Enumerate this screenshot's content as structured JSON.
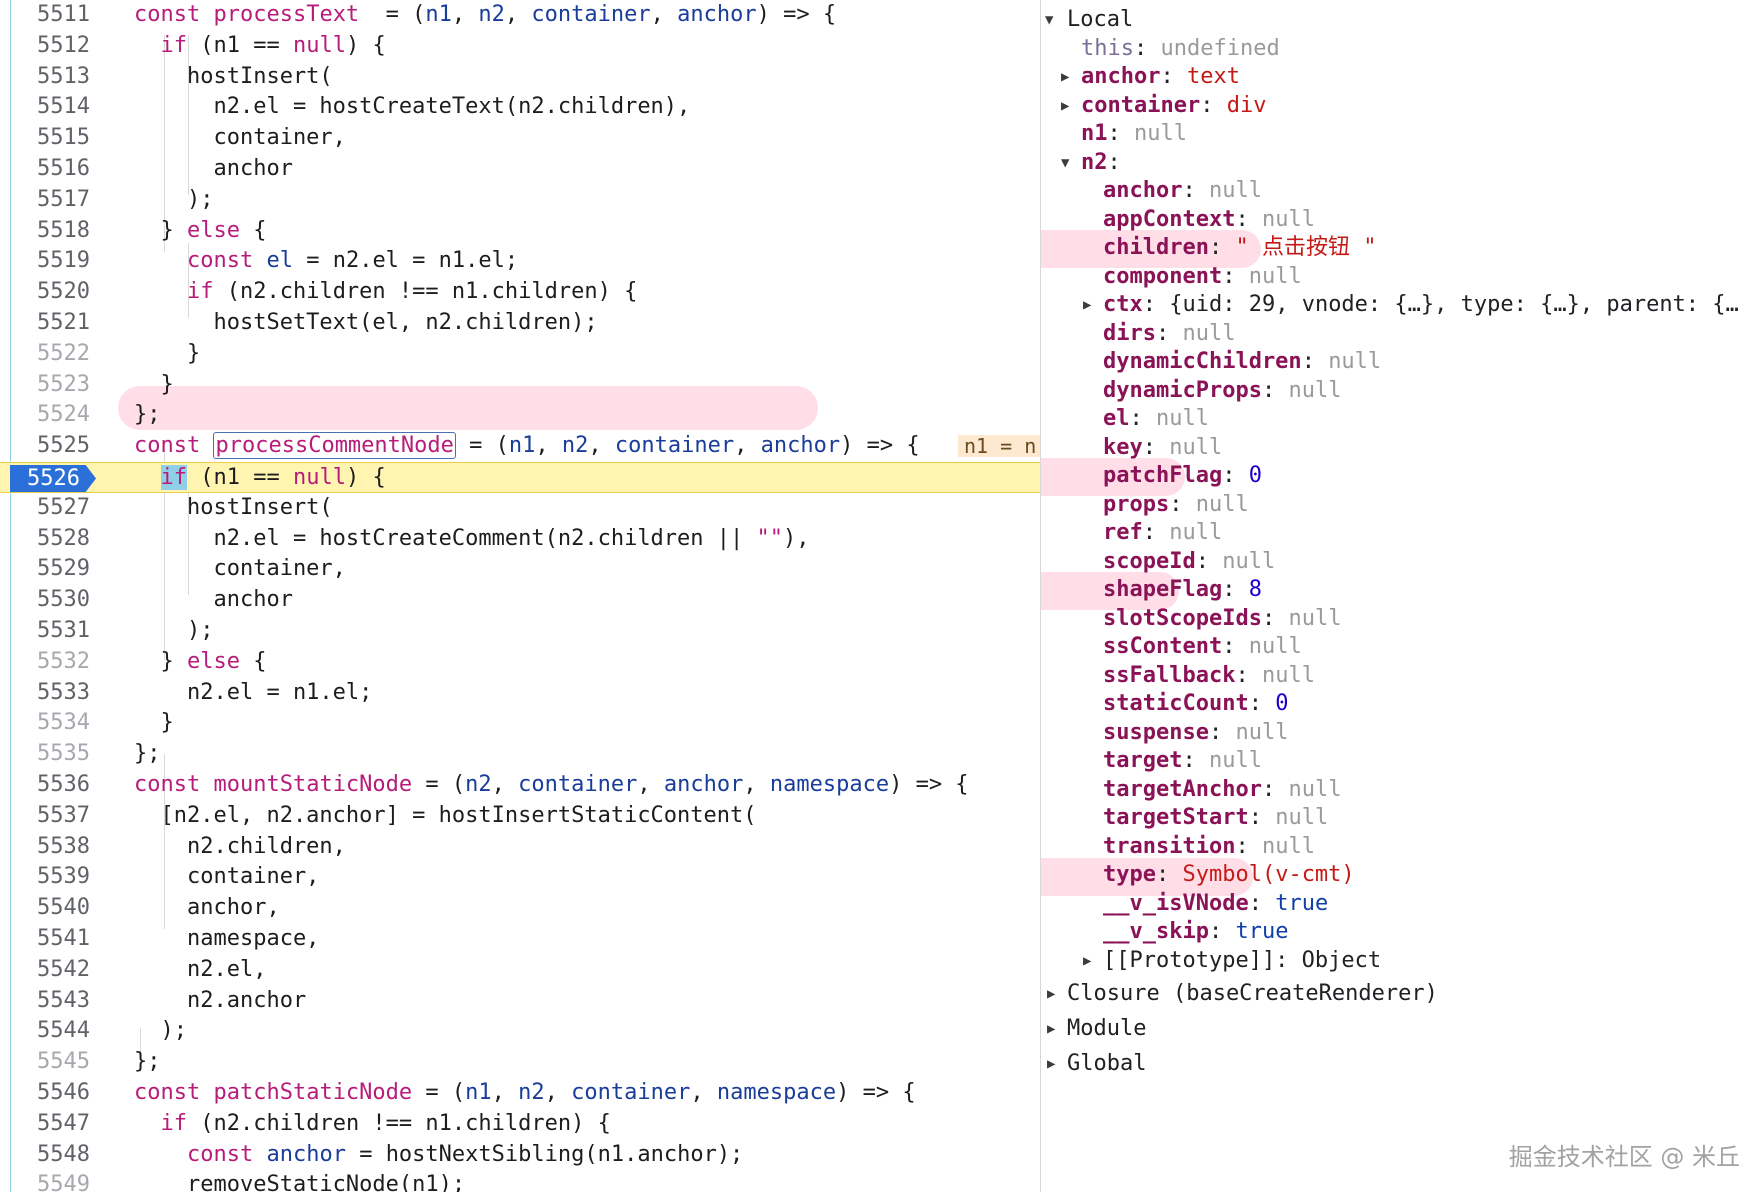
{
  "editor": {
    "breakpoint_line": "5526",
    "inline_value": "n1 = n",
    "lines": [
      {
        "n": "5511",
        "t": [
          [
            "kw",
            "const "
          ],
          [
            "fn",
            "processText"
          ],
          [
            "",
            "  = ("
          ],
          [
            "pa",
            "n1"
          ],
          [
            "",
            ", "
          ],
          [
            "pa",
            "n2"
          ],
          [
            "",
            ", "
          ],
          [
            "pa",
            "container"
          ],
          [
            "",
            ", "
          ],
          [
            "pa",
            "anchor"
          ],
          [
            "",
            ") => {"
          ]
        ]
      },
      {
        "n": "5512",
        "t": [
          [
            "",
            "  "
          ],
          [
            "kw",
            "if"
          ],
          [
            "",
            " (n1 == "
          ],
          [
            "nl",
            "null"
          ],
          [
            "",
            ") {"
          ]
        ]
      },
      {
        "n": "5513",
        "t": [
          [
            "",
            "    hostInsert("
          ]
        ]
      },
      {
        "n": "5514",
        "t": [
          [
            "",
            "      n2.el = hostCreateText(n2.children),"
          ]
        ]
      },
      {
        "n": "5515",
        "t": [
          [
            "",
            "      container,"
          ]
        ]
      },
      {
        "n": "5516",
        "t": [
          [
            "",
            "      anchor"
          ]
        ]
      },
      {
        "n": "5517",
        "t": [
          [
            "",
            "    );"
          ]
        ]
      },
      {
        "n": "5518",
        "t": [
          [
            "",
            "  } "
          ],
          [
            "kw",
            "else"
          ],
          [
            "",
            " {"
          ]
        ]
      },
      {
        "n": "5519",
        "t": [
          [
            "",
            "    "
          ],
          [
            "kw",
            "const"
          ],
          [
            "",
            " "
          ],
          [
            "pa",
            "el"
          ],
          [
            "",
            " = n2.el = n1.el;"
          ]
        ]
      },
      {
        "n": "5520",
        "t": [
          [
            "",
            "    "
          ],
          [
            "kw",
            "if"
          ],
          [
            "",
            " (n2.children !== n1.children) {"
          ]
        ]
      },
      {
        "n": "5521",
        "t": [
          [
            "",
            "      hostSetText(el, n2.children);"
          ]
        ]
      },
      {
        "n": "5522",
        "t": [
          [
            "",
            "    }"
          ]
        ]
      },
      {
        "n": "5523",
        "t": [
          [
            "",
            "  }"
          ]
        ]
      },
      {
        "n": "5524",
        "t": [
          [
            "",
            "};"
          ]
        ]
      },
      {
        "n": "5525",
        "t": [
          [
            "kw",
            "const "
          ],
          [
            "box",
            "processCommentNode"
          ],
          [
            "",
            " = ("
          ],
          [
            "pa",
            "n1"
          ],
          [
            "",
            ", "
          ],
          [
            "pa",
            "n2"
          ],
          [
            "",
            ", "
          ],
          [
            "pa",
            "container"
          ],
          [
            "",
            ", "
          ],
          [
            "pa",
            "anchor"
          ],
          [
            "",
            ") => {"
          ]
        ]
      },
      {
        "n": "5526",
        "t": [
          [
            "",
            "  "
          ],
          [
            "hlif",
            "if"
          ],
          [
            "",
            " (n1 == "
          ],
          [
            "nl",
            "null"
          ],
          [
            "",
            ") {"
          ]
        ]
      },
      {
        "n": "5527",
        "t": [
          [
            "",
            "    hostInsert("
          ]
        ]
      },
      {
        "n": "5528",
        "t": [
          [
            "",
            "      n2.el = hostCreateComment(n2.children || "
          ],
          [
            "str",
            "\"\""
          ],
          [
            "",
            "),"
          ]
        ]
      },
      {
        "n": "5529",
        "t": [
          [
            "",
            "      container,"
          ]
        ]
      },
      {
        "n": "5530",
        "t": [
          [
            "",
            "      anchor"
          ]
        ]
      },
      {
        "n": "5531",
        "t": [
          [
            "",
            "    );"
          ]
        ]
      },
      {
        "n": "5532",
        "t": [
          [
            "",
            "  } "
          ],
          [
            "kw",
            "else"
          ],
          [
            "",
            " {"
          ]
        ]
      },
      {
        "n": "5533",
        "t": [
          [
            "",
            "    n2.el = n1.el;"
          ]
        ]
      },
      {
        "n": "5534",
        "t": [
          [
            "",
            "  }"
          ]
        ]
      },
      {
        "n": "5535",
        "t": [
          [
            "",
            "};"
          ]
        ]
      },
      {
        "n": "5536",
        "t": [
          [
            "kw",
            "const "
          ],
          [
            "fn",
            "mountStaticNode"
          ],
          [
            "",
            " = ("
          ],
          [
            "pa",
            "n2"
          ],
          [
            "",
            ", "
          ],
          [
            "pa",
            "container"
          ],
          [
            "",
            ", "
          ],
          [
            "pa",
            "anchor"
          ],
          [
            "",
            ", "
          ],
          [
            "pa",
            "namespace"
          ],
          [
            "",
            ") => {"
          ]
        ]
      },
      {
        "n": "5537",
        "t": [
          [
            "",
            "  [n2.el, n2.anchor] = hostInsertStaticContent("
          ]
        ]
      },
      {
        "n": "5538",
        "t": [
          [
            "",
            "    n2.children,"
          ]
        ]
      },
      {
        "n": "5539",
        "t": [
          [
            "",
            "    container,"
          ]
        ]
      },
      {
        "n": "5540",
        "t": [
          [
            "",
            "    anchor,"
          ]
        ]
      },
      {
        "n": "5541",
        "t": [
          [
            "",
            "    namespace,"
          ]
        ]
      },
      {
        "n": "5542",
        "t": [
          [
            "",
            "    n2.el,"
          ]
        ]
      },
      {
        "n": "5543",
        "t": [
          [
            "",
            "    n2.anchor"
          ]
        ]
      },
      {
        "n": "5544",
        "t": [
          [
            "",
            "  );"
          ]
        ]
      },
      {
        "n": "5545",
        "t": [
          [
            "",
            "};"
          ]
        ]
      },
      {
        "n": "5546",
        "t": [
          [
            "kw",
            "const "
          ],
          [
            "fn",
            "patchStaticNode"
          ],
          [
            "",
            " = ("
          ],
          [
            "pa",
            "n1"
          ],
          [
            "",
            ", "
          ],
          [
            "pa",
            "n2"
          ],
          [
            "",
            ", "
          ],
          [
            "pa",
            "container"
          ],
          [
            "",
            ", "
          ],
          [
            "pa",
            "namespace"
          ],
          [
            "",
            ") => {"
          ]
        ]
      },
      {
        "n": "5547",
        "t": [
          [
            "",
            "  "
          ],
          [
            "kw",
            "if"
          ],
          [
            "",
            " (n2.children !== n1.children) {"
          ]
        ]
      },
      {
        "n": "5548",
        "t": [
          [
            "",
            "    "
          ],
          [
            "kw",
            "const"
          ],
          [
            "",
            " "
          ],
          [
            "pa",
            "anchor"
          ],
          [
            "",
            " = hostNextSibling(n1.anchor);"
          ]
        ]
      },
      {
        "n": "5549",
        "t": [
          [
            "",
            "    removeStaticNode(n1);"
          ]
        ]
      }
    ]
  },
  "scope": {
    "local_label": "Local",
    "this_key": "this",
    "this_val": "undefined",
    "top": [
      {
        "k": "anchor",
        "v": "text",
        "cls": "v-str",
        "expand": true
      },
      {
        "k": "container",
        "v": "div",
        "cls": "v-str",
        "expand": true
      },
      {
        "k": "n1",
        "v": "null",
        "cls": "v-null",
        "expand": false
      }
    ],
    "n2_key": "n2",
    "n2_props": [
      {
        "k": "anchor",
        "v": "null",
        "cls": "v-null"
      },
      {
        "k": "appContext",
        "v": "null",
        "cls": "v-null"
      },
      {
        "k": "children",
        "v": "\" 点击按钮 \"",
        "cls": "v-str"
      },
      {
        "k": "component",
        "v": "null",
        "cls": "v-null"
      },
      {
        "k": "ctx",
        "v": "{uid: 29, vnode: {…}, type: {…}, parent: {…",
        "cls": "v-plain",
        "expand": true
      },
      {
        "k": "dirs",
        "v": "null",
        "cls": "v-null"
      },
      {
        "k": "dynamicChildren",
        "v": "null",
        "cls": "v-null"
      },
      {
        "k": "dynamicProps",
        "v": "null",
        "cls": "v-null"
      },
      {
        "k": "el",
        "v": "null",
        "cls": "v-null"
      },
      {
        "k": "key",
        "v": "null",
        "cls": "v-null"
      },
      {
        "k": "patchFlag",
        "v": "0",
        "cls": "v-num"
      },
      {
        "k": "props",
        "v": "null",
        "cls": "v-null"
      },
      {
        "k": "ref",
        "v": "null",
        "cls": "v-null"
      },
      {
        "k": "scopeId",
        "v": "null",
        "cls": "v-null"
      },
      {
        "k": "shapeFlag",
        "v": "8",
        "cls": "v-num"
      },
      {
        "k": "slotScopeIds",
        "v": "null",
        "cls": "v-null"
      },
      {
        "k": "ssContent",
        "v": "null",
        "cls": "v-null"
      },
      {
        "k": "ssFallback",
        "v": "null",
        "cls": "v-null"
      },
      {
        "k": "staticCount",
        "v": "0",
        "cls": "v-num"
      },
      {
        "k": "suspense",
        "v": "null",
        "cls": "v-null"
      },
      {
        "k": "target",
        "v": "null",
        "cls": "v-null"
      },
      {
        "k": "targetAnchor",
        "v": "null",
        "cls": "v-null"
      },
      {
        "k": "targetStart",
        "v": "null",
        "cls": "v-null"
      },
      {
        "k": "transition",
        "v": "null",
        "cls": "v-null"
      },
      {
        "k": "type",
        "v": "Symbol(v-cmt)",
        "cls": "v-str"
      },
      {
        "k": "__v_isVNode",
        "v": "true",
        "cls": "v-kw"
      },
      {
        "k": "__v_skip",
        "v": "true",
        "cls": "v-kw"
      }
    ],
    "prototype_label": "[[Prototype]]: Object",
    "closure_label": "Closure (baseCreateRenderer)",
    "module_label": "Module",
    "global_label": "Global"
  },
  "watermark": "掘金技术社区 @ 米丘"
}
